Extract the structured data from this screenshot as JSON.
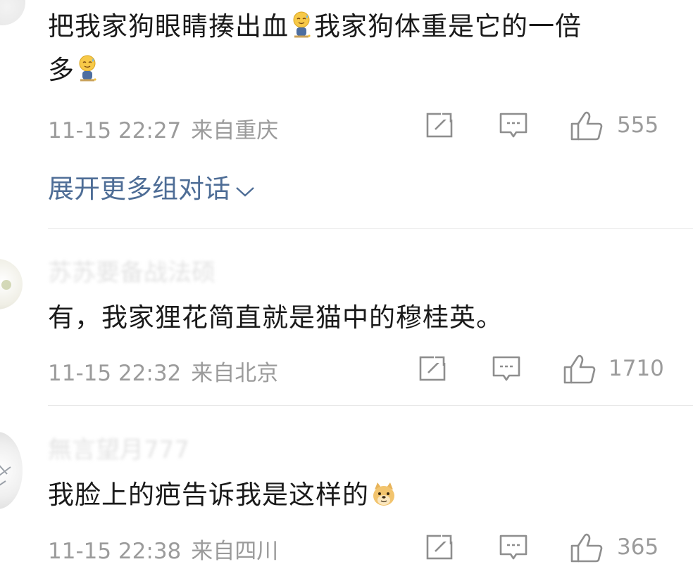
{
  "comments": [
    {
      "text_line1": "把我家狗眼睛揍出血",
      "text_line1b": "我家狗体重是它的一倍",
      "text_line2": "多",
      "time": "11-15 22:27",
      "location": "来自重庆",
      "likes": "555"
    },
    {
      "username": "苏苏要备战法硕",
      "text": "有，我家狸花简直就是猫中的穆桂英。",
      "time": "11-15 22:32",
      "location": "来自北京",
      "likes": "1710"
    },
    {
      "username": "無言望月777",
      "text": "我脸上的疤告诉我是这样的",
      "time": "11-15 22:38",
      "location": "来自四川",
      "likes": "365"
    }
  ],
  "expand_label": "展开更多组对话",
  "icons": {
    "share": "share-icon",
    "comment": "comment-icon",
    "like": "like-icon",
    "emoji_sweat": "sweat-smile-emoji",
    "emoji_doge": "doge-emoji",
    "chevron": "chevron-down-icon"
  },
  "colors": {
    "link": "#4e6d96",
    "meta": "#9b9b9b",
    "text": "#1a1a1a"
  }
}
